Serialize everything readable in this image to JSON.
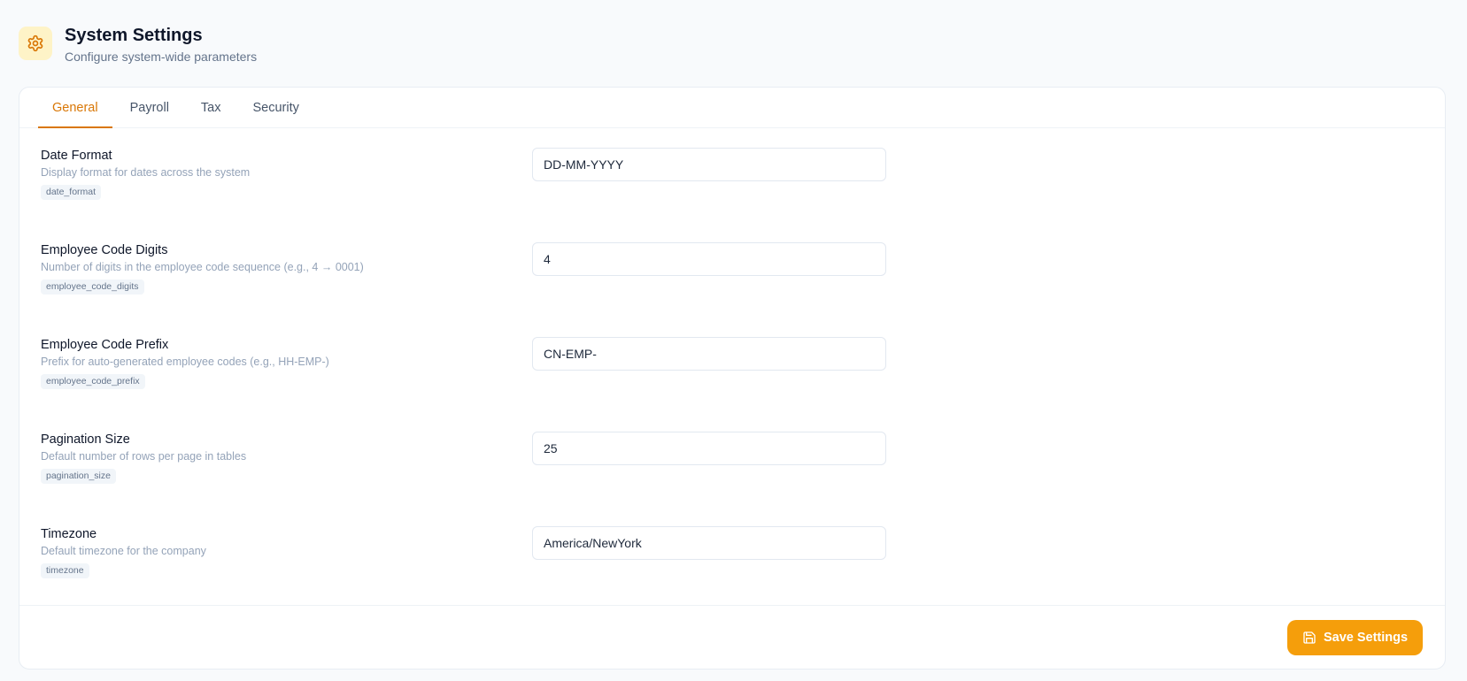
{
  "header": {
    "icon": "gear-icon",
    "title": "System Settings",
    "subtitle": "Configure system-wide parameters"
  },
  "tabs": [
    {
      "label": "General",
      "active": true
    },
    {
      "label": "Payroll",
      "active": false
    },
    {
      "label": "Tax",
      "active": false
    },
    {
      "label": "Security",
      "active": false
    }
  ],
  "settings": [
    {
      "label": "Date Format",
      "description": "Display format for dates across the system",
      "key": "date_format",
      "value": "DD-MM-YYYY"
    },
    {
      "label": "Employee Code Digits",
      "description": "Number of digits in the employee code sequence (e.g., 4 → 0001)",
      "key": "employee_code_digits",
      "value": "4"
    },
    {
      "label": "Employee Code Prefix",
      "description": "Prefix for auto-generated employee codes (e.g., HH-EMP-)",
      "key": "employee_code_prefix",
      "value": "CN-EMP-"
    },
    {
      "label": "Pagination Size",
      "description": "Default number of rows per page in tables",
      "key": "pagination_size",
      "value": "25"
    },
    {
      "label": "Timezone",
      "description": "Default timezone for the company",
      "key": "timezone",
      "value": "America/NewYork"
    }
  ],
  "footer": {
    "save_label": "Save Settings",
    "save_icon": "save-icon"
  },
  "colors": {
    "accent": "#f59e0b",
    "accent_text": "#d97706",
    "icon_bg": "#fef3c7"
  }
}
